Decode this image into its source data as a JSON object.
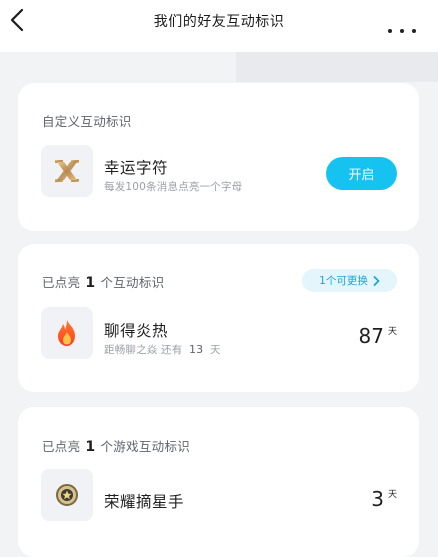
{
  "nav": {
    "title": "我们的好友互动标识",
    "back_icon": "chevron-left-icon",
    "more_icon": "more-horizontal-icon"
  },
  "custom_section": {
    "title": "自定义互动标识",
    "item": {
      "name": "幸运字符",
      "desc": "每发100条消息点亮一个字母",
      "icon": "letter-x-badge-icon",
      "button_label": "开启"
    }
  },
  "lit_section": {
    "title_prefix": "已点亮",
    "count": "1",
    "title_suffix": "个互动标识",
    "replace_label": "1个可更换",
    "item": {
      "name": "聊得炎热",
      "desc_prefix": "距畅聊之焱 还有",
      "desc_days": "13",
      "desc_unit": "天",
      "icon": "flame-icon",
      "days_value": "87",
      "days_unit": "天"
    }
  },
  "game_section": {
    "title_prefix": "已点亮",
    "count": "1",
    "title_suffix": "个游戏互动标识",
    "item": {
      "name": "荣耀摘星手",
      "icon": "star-medal-icon",
      "days_value": "3",
      "days_unit": "天"
    }
  },
  "colors": {
    "accent": "#16c3f0",
    "background": "#f2f3f5",
    "card": "#ffffff"
  }
}
